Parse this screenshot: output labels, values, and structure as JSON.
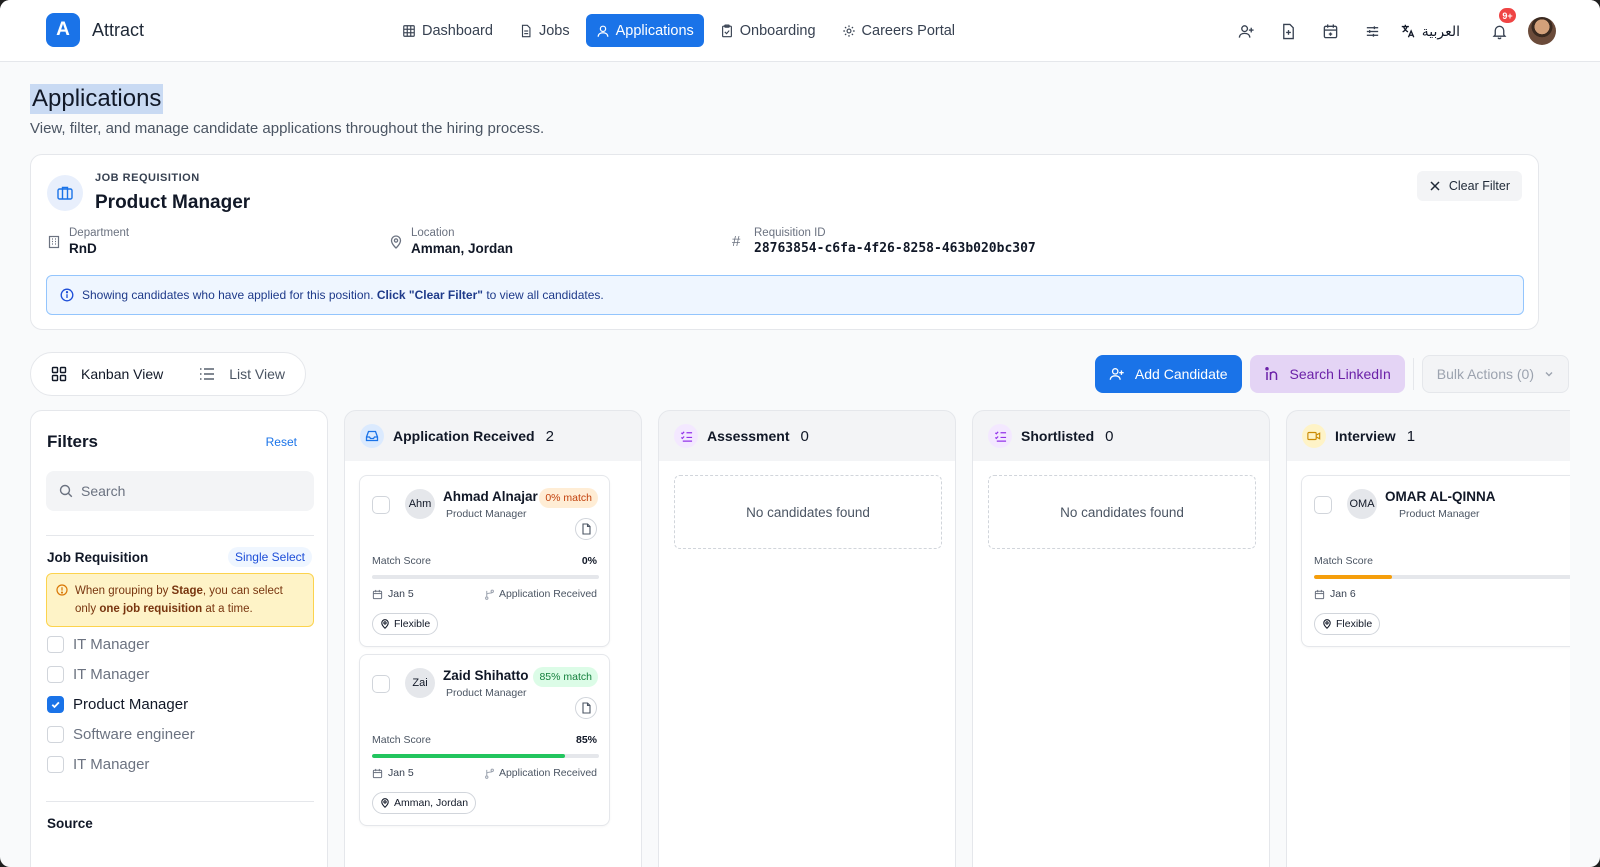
{
  "app": {
    "logo_letter": "A",
    "name": "Attract"
  },
  "nav": [
    {
      "label": "Dashboard",
      "icon": "grid-icon",
      "active": false
    },
    {
      "label": "Jobs",
      "icon": "document-icon",
      "active": false
    },
    {
      "label": "Applications",
      "icon": "user-icon",
      "active": true
    },
    {
      "label": "Onboarding",
      "icon": "clipboard-icon",
      "active": false
    },
    {
      "label": "Careers Portal",
      "icon": "gear-icon",
      "active": false
    }
  ],
  "toolbar": {
    "language": "العربية",
    "notification_badge": "9+"
  },
  "header": {
    "title": "Applications",
    "subtitle": "View, filter, and manage candidate applications throughout the hiring process."
  },
  "requisition": {
    "kicker": "JOB REQUISITION",
    "title": "Product Manager",
    "clear_label": "Clear Filter",
    "department_label": "Department",
    "department": "RnD",
    "location_label": "Location",
    "location": "Amman, Jordan",
    "id_label": "Requisition ID",
    "id": "28763854-c6fa-4f26-8258-463b020bc307",
    "info_pre": "Showing candidates who have applied for this position.",
    "info_bold": "Click \"Clear Filter\"",
    "info_post": "to view all candidates."
  },
  "views": {
    "kanban": "Kanban View",
    "list": "List View",
    "active": "kanban"
  },
  "actions": {
    "add_candidate": "Add Candidate",
    "search_linkedin": "Search LinkedIn",
    "bulk_actions": "Bulk Actions (0)"
  },
  "filters": {
    "title": "Filters",
    "reset": "Reset",
    "search_placeholder": "Search",
    "job_requisition_label": "Job Requisition",
    "single_select": "Single Select",
    "warning_pre": "When grouping by",
    "warning_stage": "Stage",
    "warning_mid": ", you can select only",
    "warning_bold": "one job requisition",
    "warning_post": "at a time.",
    "options": [
      {
        "label": "IT Manager",
        "checked": false
      },
      {
        "label": "IT Manager",
        "checked": false
      },
      {
        "label": "Product Manager",
        "checked": true
      },
      {
        "label": "Software engineer",
        "checked": false
      },
      {
        "label": "IT Manager",
        "checked": false
      }
    ],
    "source_label": "Source"
  },
  "columns": [
    {
      "title": "Application Received",
      "count": "2",
      "icon": "inbox-icon",
      "color": "#1a73e8",
      "bg": "#dbeafe"
    },
    {
      "title": "Assessment",
      "count": "0",
      "icon": "checklist-icon",
      "color": "#9333ea",
      "bg": "#f3e8ff",
      "empty": "No candidates found"
    },
    {
      "title": "Shortlisted",
      "count": "0",
      "icon": "checklist-icon",
      "color": "#9333ea",
      "bg": "#f3e8ff",
      "empty": "No candidates found"
    },
    {
      "title": "Interview",
      "count": "1",
      "icon": "video-icon",
      "color": "#ca8a04",
      "bg": "#fef3c7"
    }
  ],
  "cards": [
    {
      "initials": "Ahm",
      "name": "Ahmad Alnajar",
      "role": "Product Manager",
      "match": "0% match",
      "match_style": "orange",
      "score_label": "Match Score",
      "score": "0%",
      "score_fraction": 0.0,
      "date": "Jan 5",
      "stage": "Application Received",
      "location": "Flexible"
    },
    {
      "initials": "Zai",
      "name": "Zaid Shihatto",
      "role": "Product Manager",
      "match": "85% match",
      "match_style": "green",
      "score_label": "Match Score",
      "score": "85%",
      "score_fraction": 0.85,
      "date": "Jan 5",
      "stage": "Application Received",
      "location": "Amman, Jordan"
    },
    {
      "initials": "OMA",
      "name": "OMAR AL-QINNA",
      "role": "Product Manager",
      "score_label": "Match Score",
      "score_fraction": 0.3,
      "date": "Jan 6",
      "location": "Flexible"
    }
  ],
  "colors": {
    "accent": "#1a73e8",
    "score_green": "#22c55e",
    "score_orange": "#f59e0b"
  }
}
